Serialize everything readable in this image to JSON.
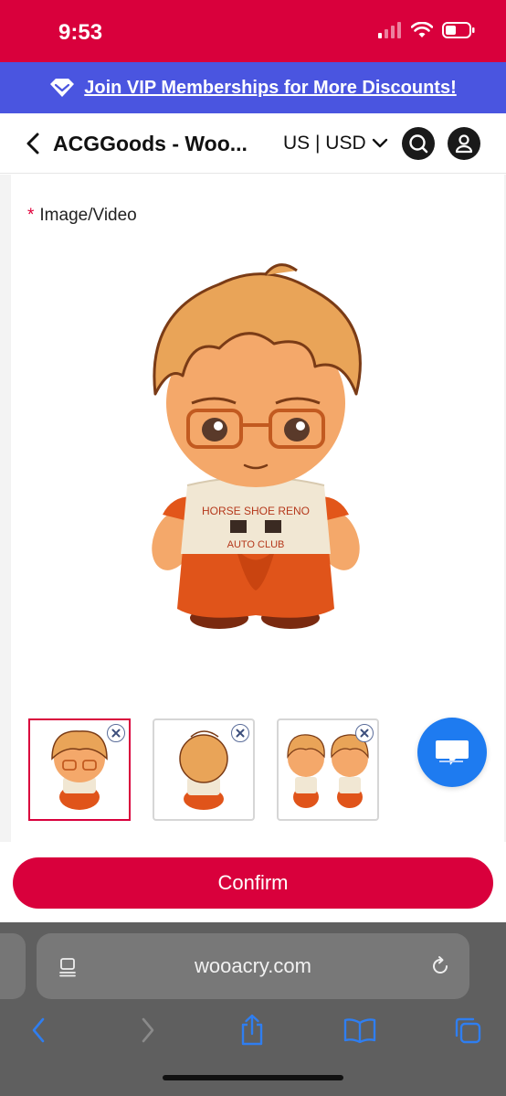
{
  "status_bar": {
    "time": "9:53"
  },
  "banner": {
    "text": "Join VIP Memberships for More Discounts!",
    "icon": "diamond-icon"
  },
  "header": {
    "title": "ACGGoods - Woo...",
    "region": "US | USD",
    "icons": [
      "back-icon",
      "chevron-down-icon",
      "search-icon",
      "user-icon"
    ]
  },
  "form": {
    "field_label": "Image/Video",
    "required_mark": "*",
    "thumbnails": [
      {
        "name": "front view",
        "selected": true
      },
      {
        "name": "back view",
        "selected": false
      },
      {
        "name": "side views",
        "selected": false
      }
    ]
  },
  "action": {
    "confirm_label": "Confirm"
  },
  "browser": {
    "url": "wooacry.com",
    "icons": [
      "reader-icon",
      "reload-icon",
      "back-icon",
      "forward-icon",
      "share-icon",
      "bookmarks-icon",
      "tabs-icon"
    ]
  },
  "colors": {
    "brand": "#d9003c",
    "banner": "#4a55e0",
    "chat": "#1e7bf0"
  }
}
